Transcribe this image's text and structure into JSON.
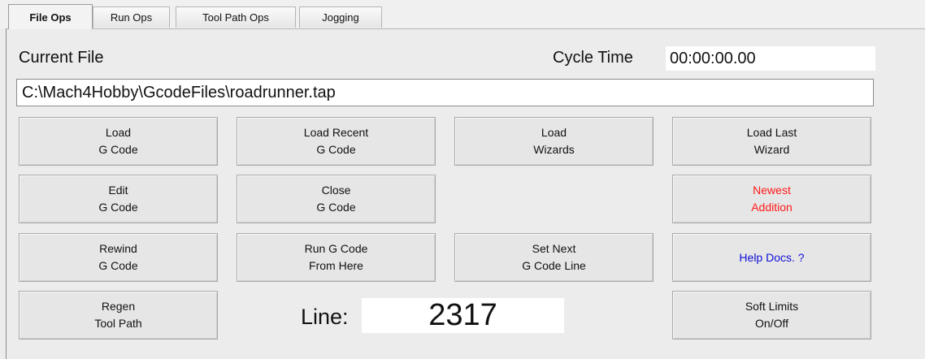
{
  "tabs": [
    "File Ops",
    "Run Ops",
    "Tool Path Ops",
    "Jogging"
  ],
  "current_file_label": "Current File",
  "cycle_time_label": "Cycle Time",
  "cycle_time_value": "00:00:00.00",
  "file_path": "C:\\Mach4Hobby\\GcodeFiles\\roadrunner.tap",
  "buttons": {
    "load_gcode": [
      "Load",
      "G Code"
    ],
    "load_recent": [
      "Load Recent",
      "G Code"
    ],
    "load_wizards": [
      "Load",
      "Wizards"
    ],
    "load_last_wizard": [
      "Load Last",
      "Wizard"
    ],
    "edit_gcode": [
      "Edit",
      "G Code"
    ],
    "close_gcode": [
      "Close",
      "G Code"
    ],
    "newest_addition": [
      "Newest",
      "Addition"
    ],
    "rewind_gcode": [
      "Rewind",
      "G Code"
    ],
    "run_from_here": [
      "Run G Code",
      "From Here"
    ],
    "set_next_line": [
      "Set Next",
      "G Code Line"
    ],
    "help_docs": [
      "Help Docs. ?"
    ],
    "regen_toolpath": [
      "Regen",
      "Tool Path"
    ],
    "soft_limits": [
      "Soft Limits",
      "On/Off"
    ]
  },
  "line_label": "Line:",
  "line_value": "2317",
  "colors": {
    "newest_addition": "#ff1a1a",
    "help_docs": "#1010d8"
  }
}
